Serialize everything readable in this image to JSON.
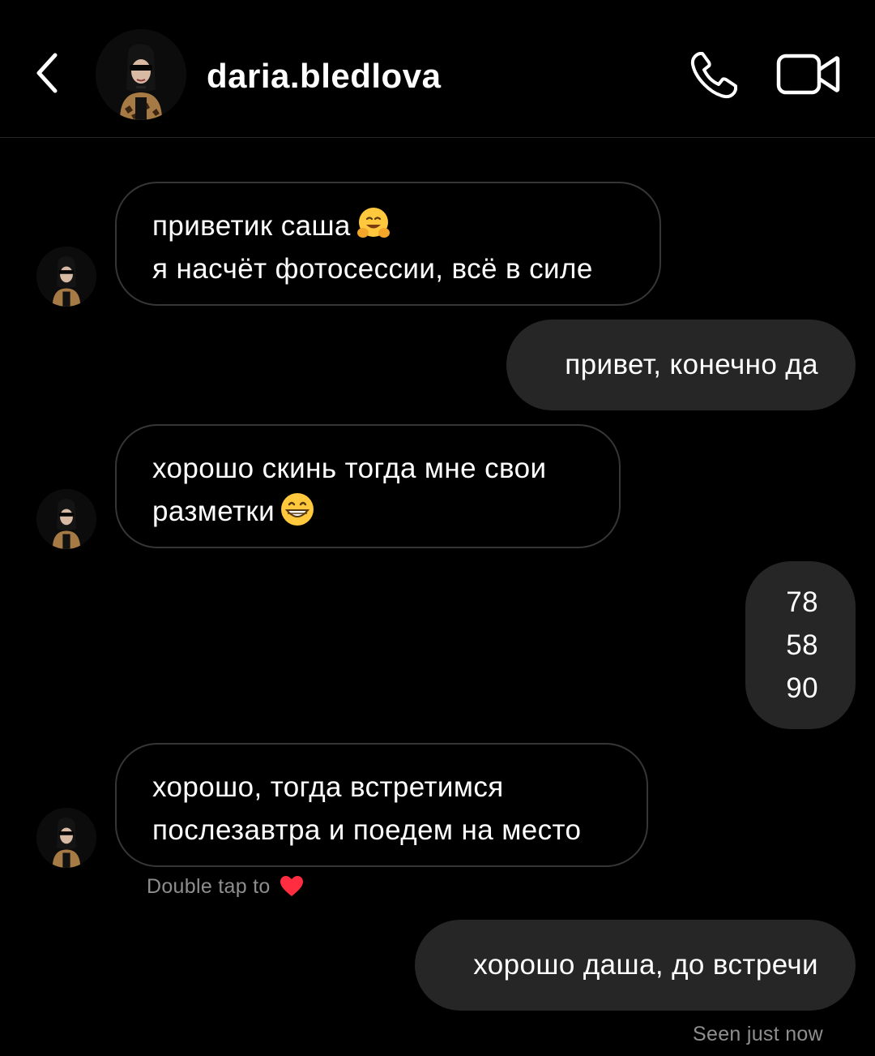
{
  "header": {
    "username": "daria.bledlova",
    "back_icon": "chevron-left-icon",
    "call_icon": "phone-icon",
    "video_icon": "video-camera-icon"
  },
  "messages": [
    {
      "side": "in",
      "lines": [
        "приветик саша",
        "я насчёт фотосессии, всё в силе"
      ],
      "emoji": "hugging-face-emoji"
    },
    {
      "side": "out",
      "lines": [
        "привет, конечно да"
      ]
    },
    {
      "side": "in",
      "lines": [
        "хорошо скинь тогда мне свои",
        "разметки"
      ],
      "emoji": "grinning-face-emoji"
    },
    {
      "side": "out",
      "lines": [
        "78",
        "58",
        "90"
      ]
    },
    {
      "side": "in",
      "lines": [
        "хорошо, тогда встретимся",
        "послезавтра и поедем на место"
      ]
    },
    {
      "side": "out",
      "lines": [
        "хорошо даша, до встречи"
      ]
    }
  ],
  "double_tap_hint": "Double tap to",
  "seen_status": "Seen just now",
  "colors": {
    "background": "#000000",
    "outgoing_bubble": "#262626",
    "incoming_border": "#363636",
    "meta_text": "#8e8e8e",
    "heart": "#ff2d3f"
  }
}
